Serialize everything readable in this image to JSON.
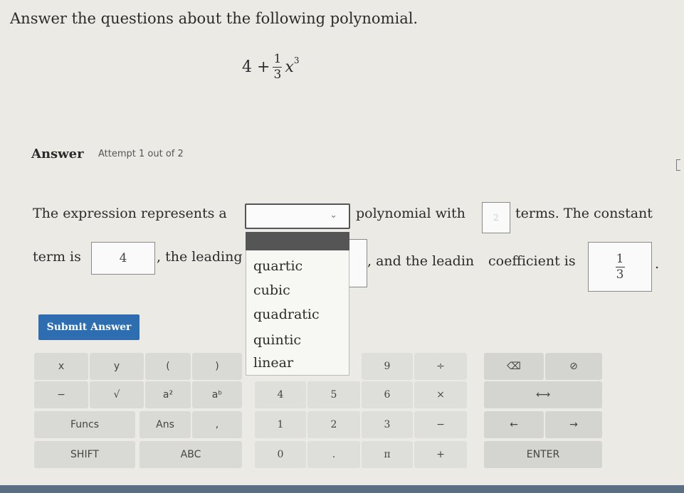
{
  "question": "Answer the questions about the following polynomial.",
  "formula": {
    "lead": "4 +",
    "numerator": "1",
    "denominator": "3",
    "var": "x",
    "exponent": "3"
  },
  "answer": {
    "heading": "Answer",
    "attempt": "Attempt 1 out of 2"
  },
  "sentence": {
    "p1": "The expression represents a",
    "p2": "polynomial with",
    "terms_value": "2",
    "p3": "terms. The constant",
    "p4": "term is",
    "constant_value": "4",
    "p5": ", the leading",
    "p6": ", and the leadin",
    "p7": "coefficient is",
    "coef_num": "1",
    "coef_den": "3",
    "p8": "."
  },
  "dropdown": {
    "options": [
      "quartic",
      "cubic",
      "quadratic",
      "quintic",
      "linear"
    ],
    "chevron": "⌄"
  },
  "submit_label": "Submit Answer",
  "keypad": {
    "row1": [
      "x",
      "y",
      "(",
      ")",
      "9",
      "÷",
      "⌫",
      "⊘"
    ],
    "row2": [
      "−",
      "√",
      "a²",
      "aᵇ",
      "4",
      "5",
      "6",
      "×",
      "⟷"
    ],
    "row3": [
      "Funcs",
      "Ans",
      ",",
      "1",
      "2",
      "3",
      "−",
      "←",
      "→"
    ],
    "row4": [
      "SHIFT",
      "ABC",
      "0",
      ".",
      "π",
      "+",
      "ENTER"
    ]
  }
}
